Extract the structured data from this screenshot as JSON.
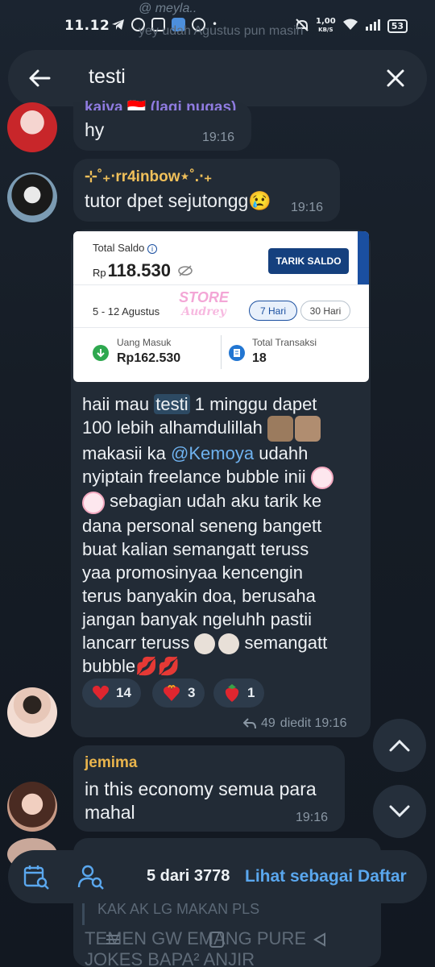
{
  "status_bar": {
    "time": "11.12",
    "speed_top": "1,00",
    "speed_bottom": "KB/S",
    "battery": "53"
  },
  "search": {
    "query": "testi"
  },
  "background_text": {
    "top_partial_name": "@ meyla..",
    "top_partial_msg": "yey udah Agustus pun masih",
    "bottom_partial_quote": "KAK AK LG MAKAN PLS",
    "bottom_partial_line1": "TEMEN GW EMANG PURE",
    "bottom_partial_line2": "JOKES BAPA² ANJIR"
  },
  "messages": [
    {
      "sender": "kaiva 🇮🇩 (lagi nugas)",
      "text": "hy",
      "time": "19:16"
    },
    {
      "sender": "⊹˚₊‧rr4inbow⋆˚.‧₊",
      "text": "tutor dpet sejutongg😢",
      "time": "19:16"
    }
  ],
  "card": {
    "total_saldo_label": "Total Saldo",
    "currency": "Rp",
    "amount": "118.530",
    "withdraw_label": "TARIK SALDO",
    "date_range": "5 - 12 Agustus",
    "chip_7": "7 Hari",
    "chip_30": "30 Hari",
    "watermark_1": "STORE",
    "watermark_2": "Audrey",
    "uang_masuk_label": "Uang Masuk",
    "uang_masuk_value": "Rp162.530",
    "transaksi_label": "Total Transaksi",
    "transaksi_value": "18"
  },
  "main_msg": {
    "line1_pre": "haii mau ",
    "line1_highlight": "testi",
    "line1_post": " 1 minggu dapet",
    "line2": "100 lebih alhamdulillah",
    "line3_pre": "makasii ka ",
    "line3_mention": "@Kemoya",
    "line3_post": " udahh",
    "line4": "nyiptain freelance bubble inii",
    "line5": "sebagian udah aku tarik ke",
    "line6": "dana personal  seneng bangett",
    "line7": "buat kalian semangatt teruss",
    "line8": "yaa promosinyaa kencengin",
    "line9": "terus banyakin doa, berusaha",
    "line10": "jangan banyak ngeluhh pastii",
    "line11_pre": "lancarr teruss ",
    "line11_post": " semangatt",
    "line12": "bubble💋💋",
    "reactions": [
      {
        "emoji": "heart",
        "count": "14"
      },
      {
        "emoji": "heart-on-fire",
        "count": "3"
      },
      {
        "emoji": "strawberry",
        "count": "1"
      }
    ],
    "forward_count": "49",
    "edited_time": "diedit 19:16"
  },
  "jemima_msg": {
    "sender": "jemima",
    "line1": "in this economy semua para",
    "line2": "mahal",
    "time": "19:16"
  },
  "bottom_bar": {
    "count": "5 dari 3778",
    "list_link": "Lihat sebagai Daftar"
  },
  "colors": {
    "accent": "#5aa7ee",
    "sender_kaiva": "#8f7be0",
    "sender_rainbow": "#f0c05a",
    "sender_jemima": "#e9b44c",
    "bubble": "#222b36",
    "background": "#141b23"
  }
}
